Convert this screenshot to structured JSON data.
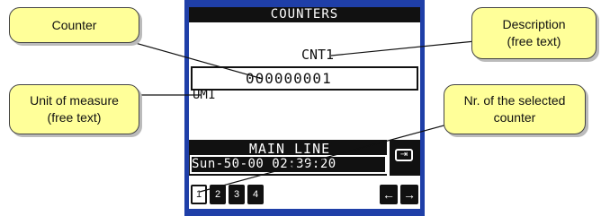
{
  "screen": {
    "title": "COUNTERS",
    "counter_name": "CNT1",
    "counter_value": "000000001",
    "unit": "UM1",
    "line_label": "MAIN LINE",
    "datetime": "Sun-50-00 02:39:20",
    "tabs": [
      "1",
      "2",
      "3",
      "4"
    ],
    "selected_tab": "1",
    "arrow_left": "←",
    "arrow_right": "→"
  },
  "callouts": {
    "counter": "Counter",
    "unit_line1": "Unit of measure",
    "unit_line2": "(free text)",
    "description_line1": "Description",
    "description_line2": "(free text)",
    "nr_line1": "Nr. of the selected",
    "nr_line2": "counter"
  },
  "colors": {
    "bezel": "#1f3fa8",
    "callout_fill": "#ffff99",
    "screen_ink": "#111111"
  }
}
